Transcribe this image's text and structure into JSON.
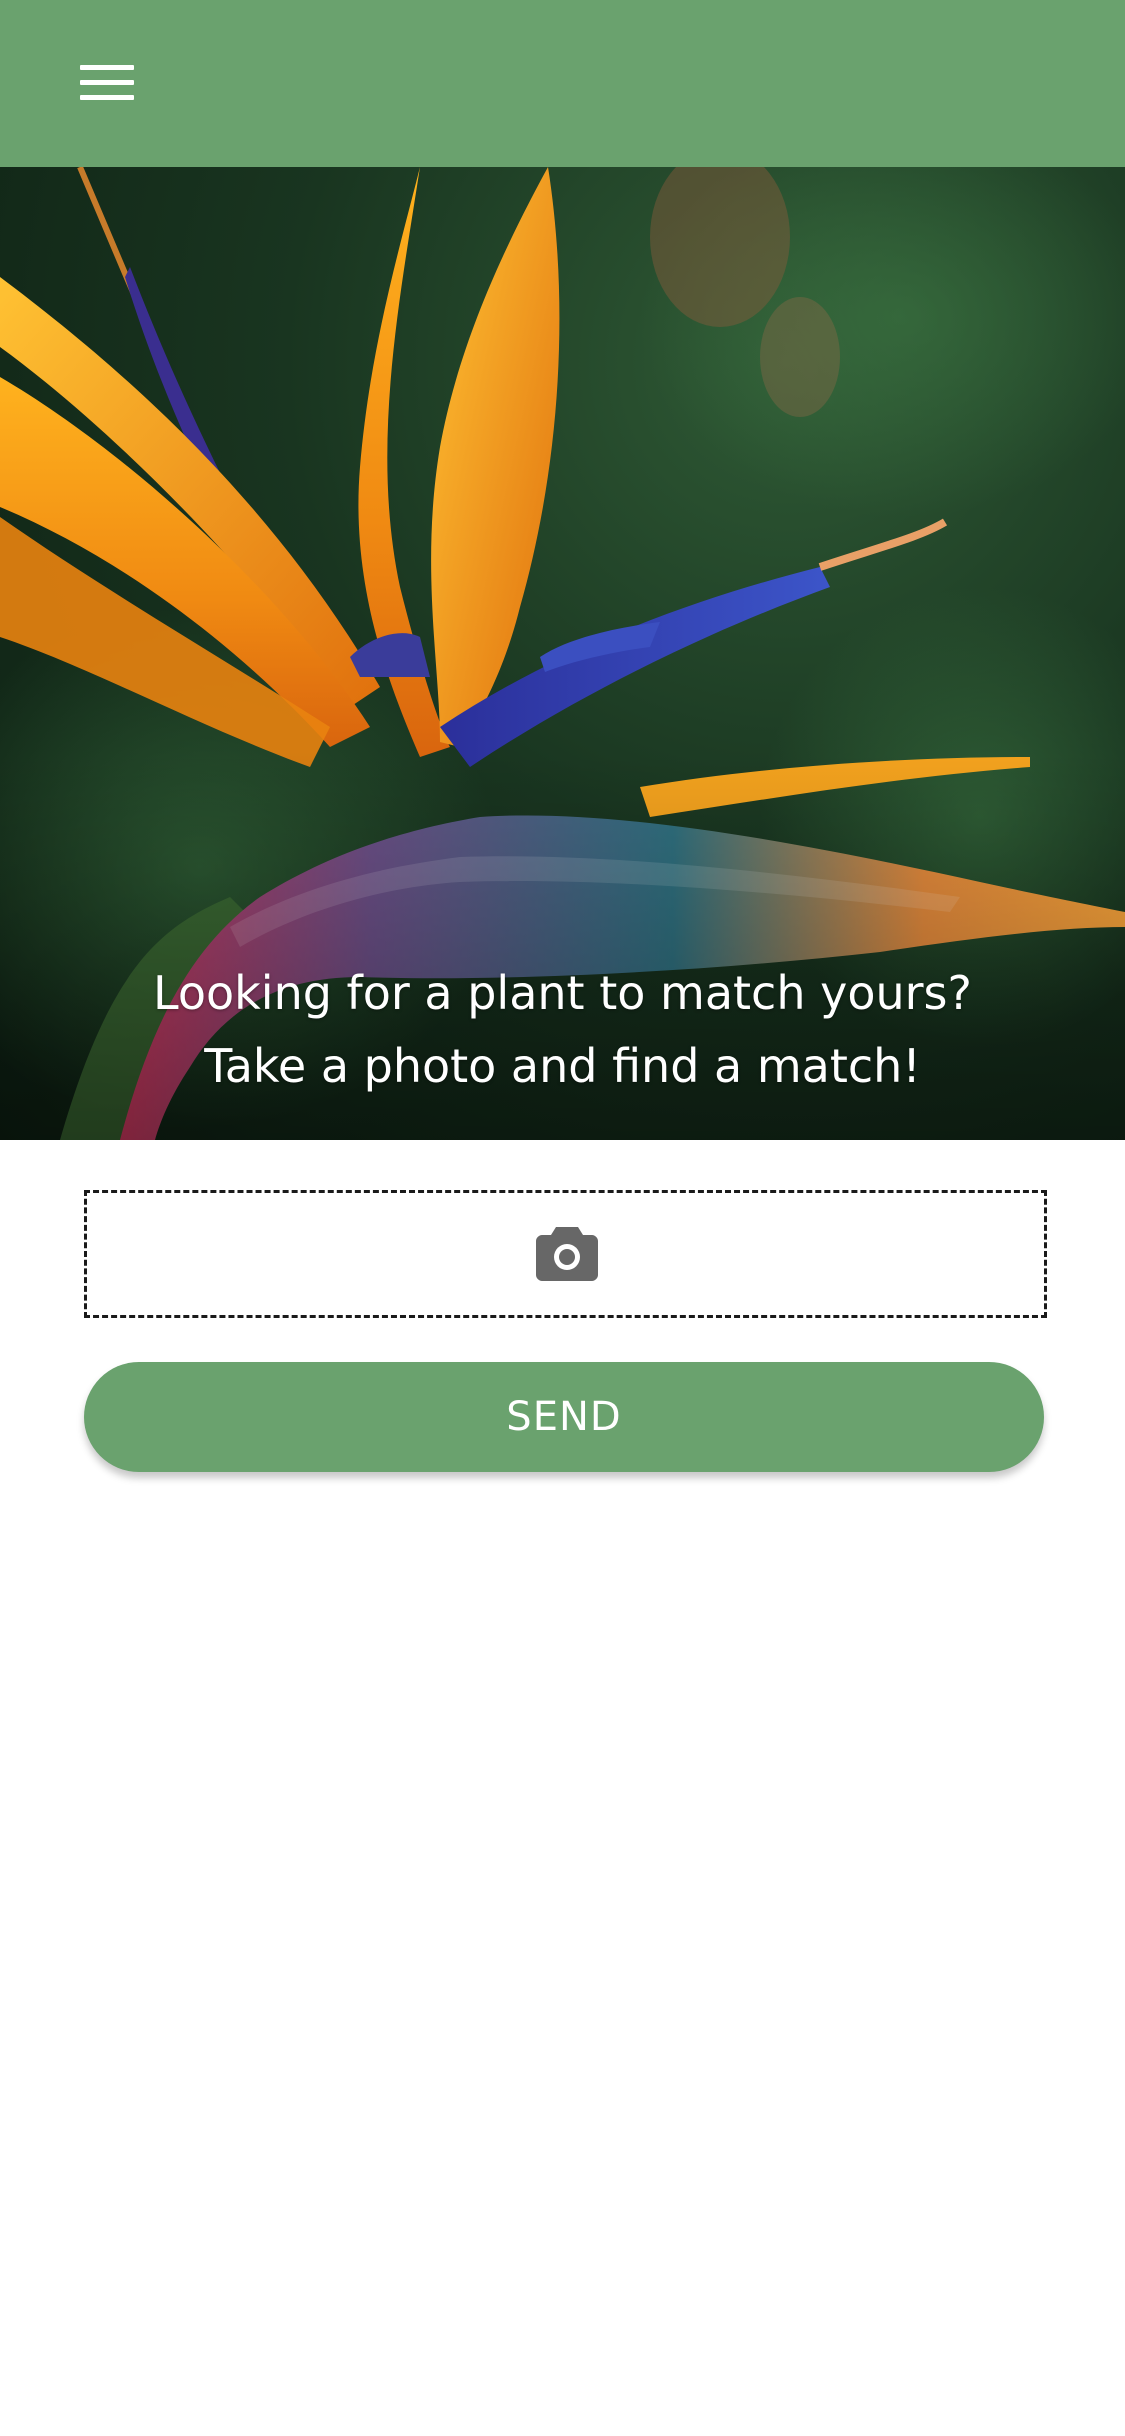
{
  "header": {
    "menu_icon": "hamburger-menu-icon",
    "background_color": "#6aa26e"
  },
  "hero": {
    "image_subject": "bird of paradise flower",
    "caption_line1": "Looking for a plant to match yours?",
    "caption_line2": "Take a photo and find a match!"
  },
  "upload": {
    "icon": "camera-icon"
  },
  "actions": {
    "send_label": "SEND",
    "send_color": "#6aa26e"
  }
}
